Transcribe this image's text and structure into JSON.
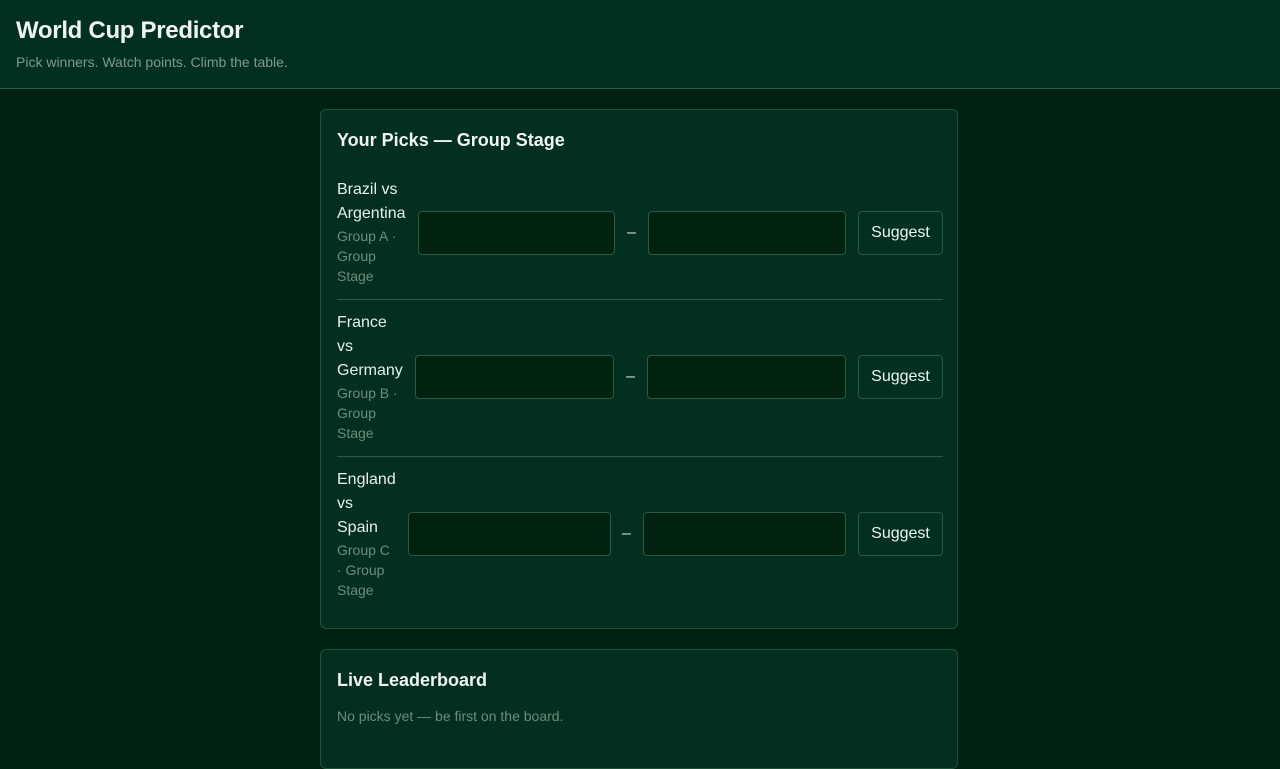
{
  "header": {
    "title": "World Cup Predictor",
    "subtitle": "Pick winners. Watch points. Climb the table."
  },
  "picks": {
    "title": "Your Picks — Group Stage",
    "dash": "–",
    "suggest_label": "Suggest",
    "matches": [
      {
        "teams_lines": [
          "Brazil vs",
          "Argentina"
        ],
        "meta_lines": [
          "Group A ·",
          "Group",
          "Stage"
        ]
      },
      {
        "teams_lines": [
          "France",
          "vs",
          "Germany"
        ],
        "meta_lines": [
          "Group B ·",
          "Group",
          "Stage"
        ]
      },
      {
        "teams_lines": [
          "England",
          "vs",
          "Spain"
        ],
        "meta_lines": [
          "Group C",
          "· Group",
          "Stage"
        ]
      }
    ]
  },
  "leaderboard": {
    "title": "Live Leaderboard",
    "empty_text": "No picks yet — be first on the board."
  }
}
